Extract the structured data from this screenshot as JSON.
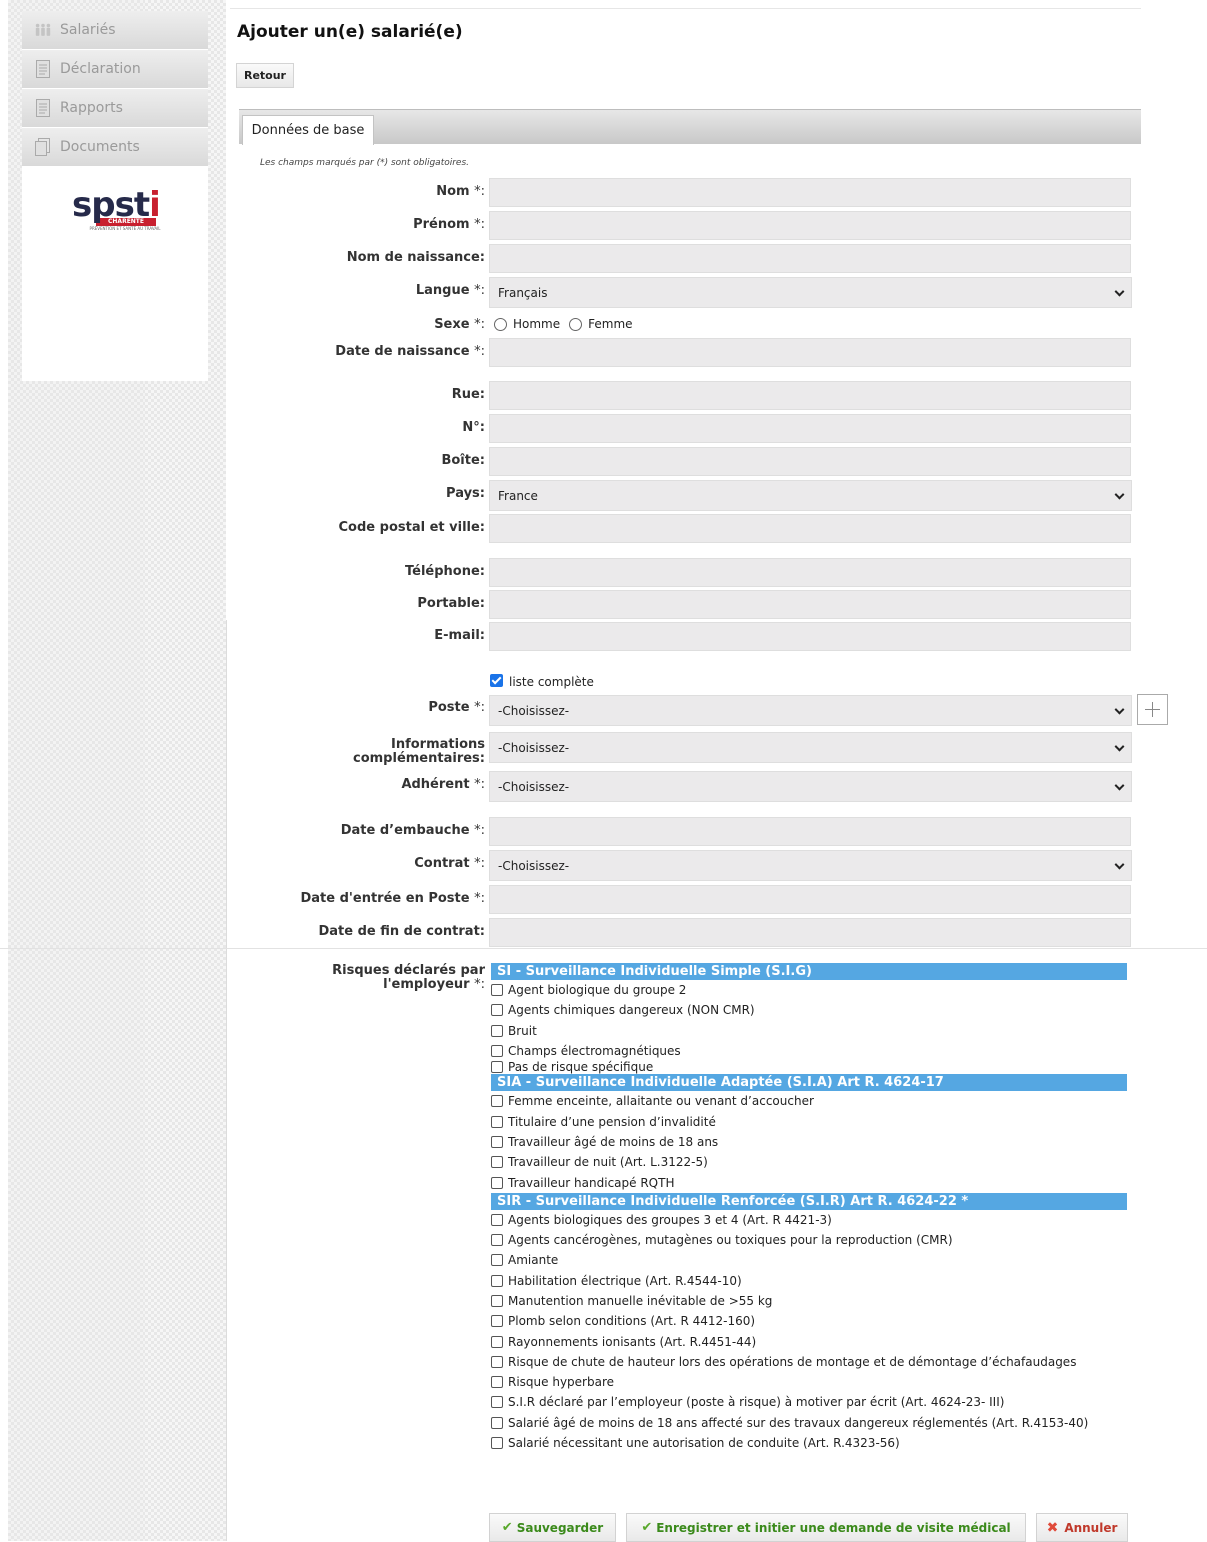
{
  "sidebar": {
    "items": [
      {
        "label": "Salariés",
        "icon": "people-icon"
      },
      {
        "label": "Déclaration",
        "icon": "document-icon"
      },
      {
        "label": "Rapports",
        "icon": "report-icon"
      },
      {
        "label": "Documents",
        "icon": "documents-icon"
      }
    ],
    "logo": {
      "text_main": "spst",
      "text_i": "i",
      "text_sub": "CHARENTE",
      "text_tag": "PRÉVENTION ET SANTÉ AU TRAVAIL"
    }
  },
  "page": {
    "title": "Ajouter un(e) salarié(e)",
    "back_label": "Retour",
    "tab_label": "Données de base",
    "required_note": "Les champs marqués par (*) sont obligatoires."
  },
  "form": {
    "nom": "Nom",
    "prenom": "Prénom",
    "nom_naissance": "Nom de naissance:",
    "langue": "Langue",
    "langue_value": "Français",
    "sexe": "Sexe",
    "sexe_options": [
      "Homme",
      "Femme"
    ],
    "date_naissance": "Date de naissance",
    "rue": "Rue:",
    "numero": "N°:",
    "boite": "Boîte:",
    "pays": "Pays:",
    "pays_value": "France",
    "code_postal": "Code postal et ville:",
    "telephone": "Téléphone:",
    "portable": "Portable:",
    "email": "E-mail:",
    "liste_complete": "liste complète",
    "poste": "Poste",
    "infos_compl_1": "Informations",
    "infos_compl_2": "complémentaires:",
    "adherent": "Adhérent",
    "date_embauche": "Date d’embauche",
    "contrat": "Contrat",
    "date_entree": "Date d'entrée en Poste",
    "date_fin": "Date de fin de contrat:",
    "choose": "-Choisissez-",
    "req_suffix": "*:"
  },
  "risks": {
    "label_1": "Risques déclarés par",
    "label_2": "l'employeur",
    "groups": [
      {
        "header": "SI - Surveillance Individuelle Simple (S.I.G)",
        "items": [
          "Agent biologique du groupe 2",
          "Agents chimiques dangereux (NON CMR)",
          "Bruit",
          "Champs électromagnétiques",
          "Pas de risque spécifique"
        ]
      },
      {
        "header": "SIA - Surveillance Individuelle Adaptée (S.I.A) Art R. 4624-17",
        "items": [
          "Femme enceinte, allaitante ou venant d’accoucher",
          "Titulaire d’une pension d’invalidité",
          "Travailleur âgé de moins de 18 ans",
          "Travailleur de nuit (Art. L.3122-5)",
          "Travailleur handicapé RQTH"
        ]
      },
      {
        "header": "SIR - Surveillance Individuelle Renforcée (S.I.R) Art R. 4624-22 *",
        "items": [
          "Agents biologiques des groupes 3 et 4 (Art. R 4421-3)",
          "Agents cancérogènes, mutagènes ou toxiques pour la reproduction (CMR)",
          "Amiante",
          "Habilitation électrique (Art. R.4544-10)",
          "Manutention manuelle inévitable de >55 kg",
          "Plomb selon conditions (Art. R 4412-160)",
          "Rayonnements ionisants (Art. R.4451-44)",
          "Risque de chute de hauteur lors des opérations de montage et de démontage d’échafaudages",
          "Risque hyperbare",
          "S.I.R déclaré par l’employeur (poste à risque) à motiver par écrit (Art. 4624-23- III)",
          "Salarié âgé de moins de 18 ans affecté sur des travaux dangereux réglementés (Art. R.4153-40)",
          "Salarié nécessitant une autorisation de conduite (Art. R.4323-56)"
        ]
      }
    ]
  },
  "actions": {
    "save": "Sauvegarder",
    "save_visit": "Enregistrer et initier une demande de visite médical",
    "cancel": "Annuler"
  }
}
